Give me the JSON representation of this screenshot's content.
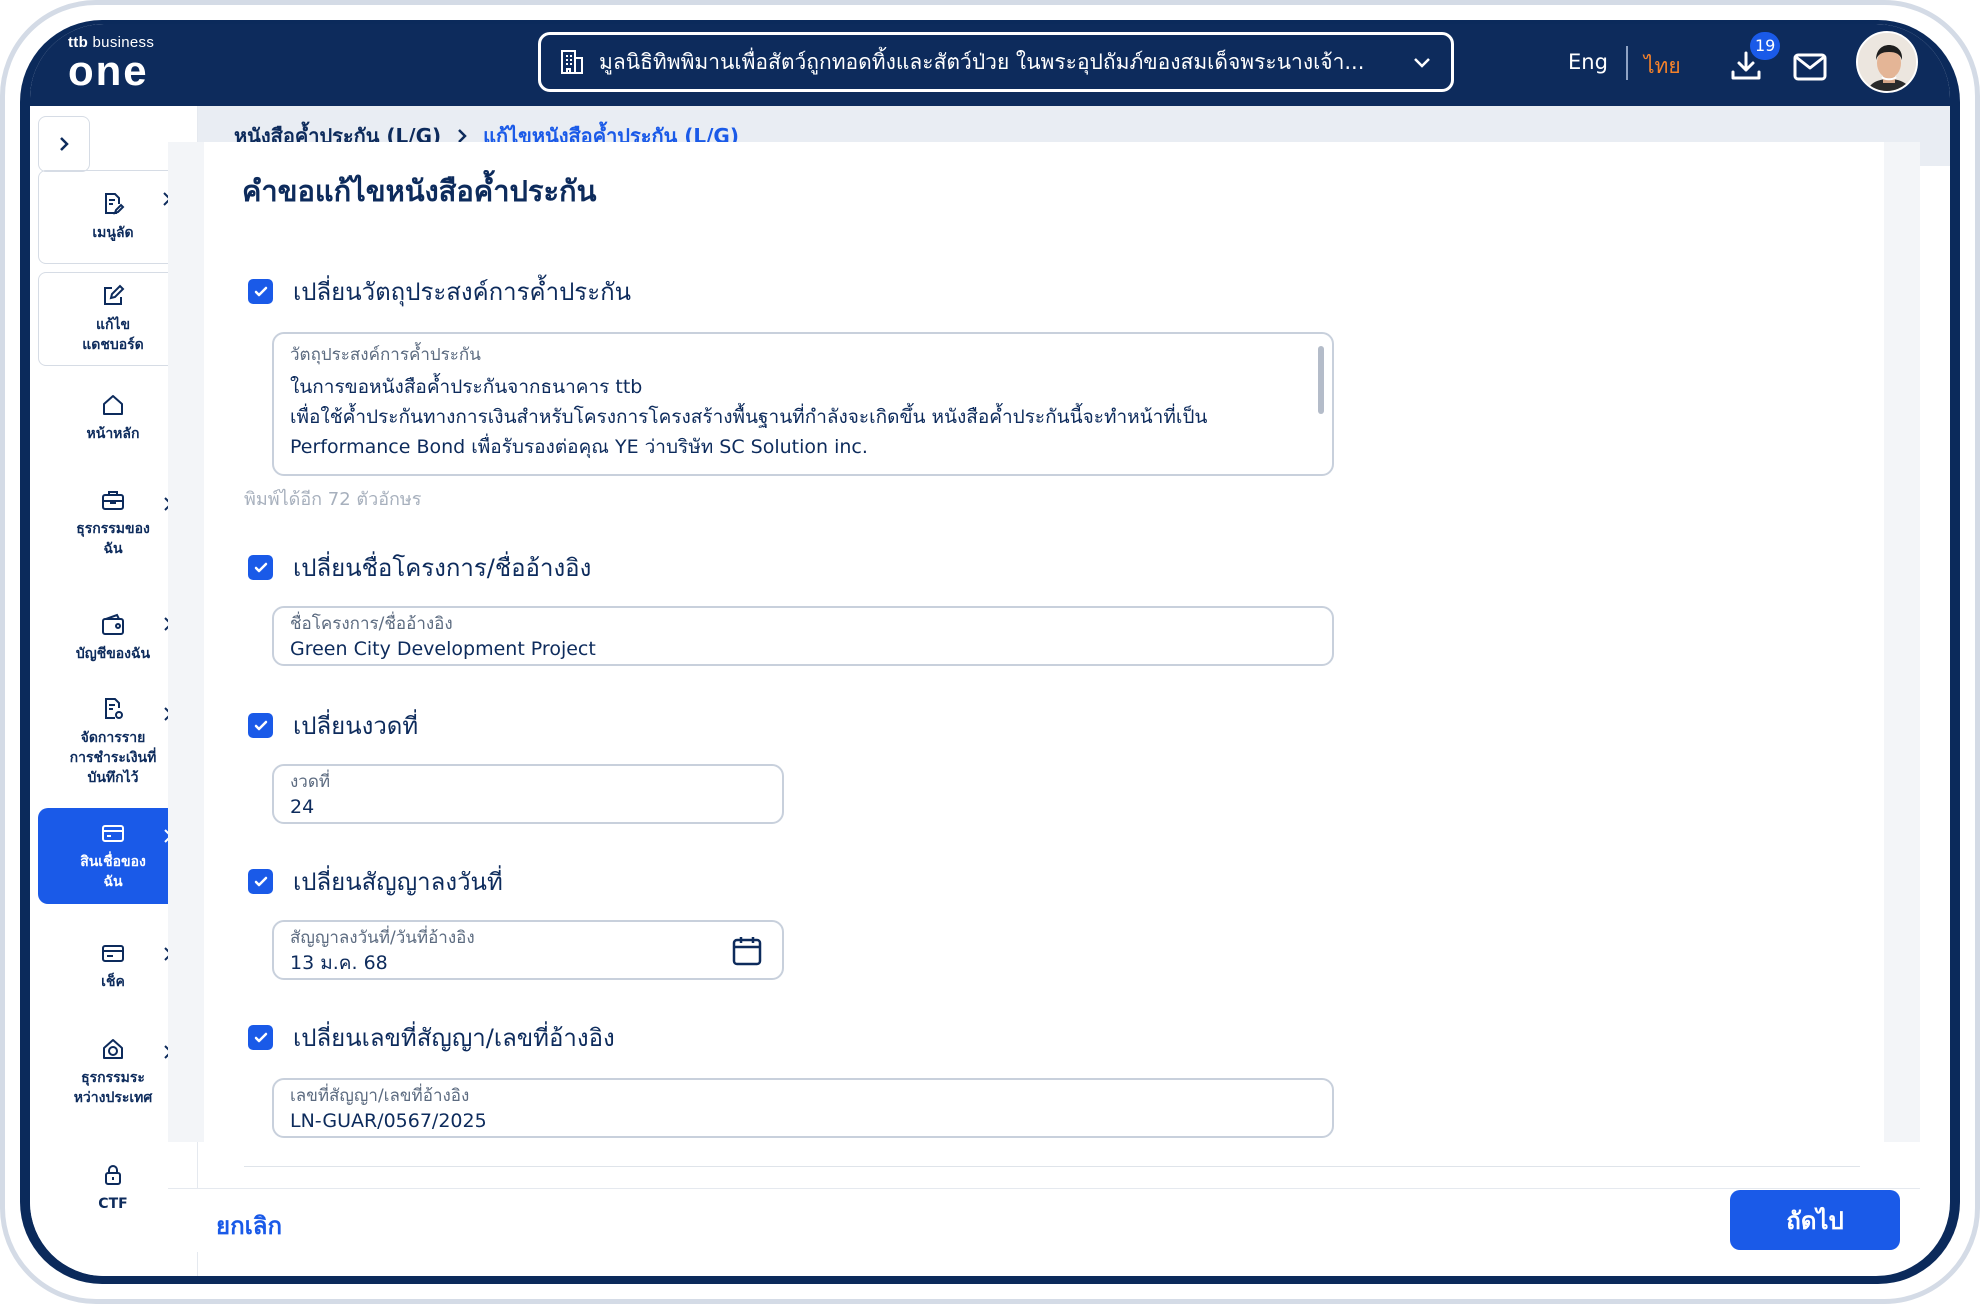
{
  "header": {
    "brand_small": "ttb",
    "brand_small2": "business",
    "brand_big": "one",
    "organization": "มูลนิธิทิพพิมานเพื่อสัตว์ถูกทอดทิ้งและสัตว์ป่วย ในพระอุปถัมภ์ของสมเด็จพระนางเจ้า...",
    "lang_en": "Eng",
    "lang_th": "ไทย",
    "download_count": "19"
  },
  "sidebar": {
    "items": [
      {
        "label": "เมนูลัด"
      },
      {
        "label": "แก้ไข\nแดชบอร์ด"
      },
      {
        "label": "หน้าหลัก"
      },
      {
        "label": "ธุรกรรมของ\nฉัน"
      },
      {
        "label": "บัญชีของฉัน"
      },
      {
        "label": "จัดการราย\nการชำระเงินที่\nบันทึกไว้"
      },
      {
        "label": "สินเชื่อของ\nฉัน"
      },
      {
        "label": "เช็ค"
      },
      {
        "label": "ธุรกรรมระ\nหว่างประเทศ"
      },
      {
        "label": "CTF"
      }
    ]
  },
  "breadcrumb": {
    "parent": "หนังสือค้ำประกัน (L/G)",
    "current": "แก้ไขหนังสือค้ำประกัน (L/G)"
  },
  "form": {
    "title": "คำขอแก้ไขหนังสือค้ำประกัน",
    "purpose": {
      "checkbox_label": "เปลี่ยนวัตถุประสงค์การค้ำประกัน",
      "field_label": "วัตถุประสงค์การค้ำประกัน",
      "line1": "ในการขอหนังสือค้ำประกันจากธนาคาร ttb",
      "line2": "เพื่อใช้ค้ำประกันทางการเงินสำหรับโครงการโครงสร้างพื้นฐานที่กำลังจะเกิดขึ้น หนังสือค้ำประกันนี้จะทำหน้าที่เป็น",
      "line3": "Performance Bond เพื่อรับรองต่อคุณ YE ว่าบริษัท SC Solution inc.",
      "counter": "พิมพ์ได้อีก 72 ตัวอักษร"
    },
    "project": {
      "checkbox_label": "เปลี่ยนชื่อโครงการ/ชื่ออ้างอิง",
      "field_label": "ชื่อโครงการ/ชื่ออ้างอิง",
      "value": "Green City Development Project"
    },
    "installment": {
      "checkbox_label": "เปลี่ยนงวดที่",
      "field_label": "งวดที่",
      "value": "24"
    },
    "contract_date": {
      "checkbox_label": "เปลี่ยนสัญญาลงวันที่",
      "field_label": "สัญญาลงวันที่/วันที่อ้างอิง",
      "value": "13 ม.ค. 68"
    },
    "contract_no": {
      "checkbox_label": "เปลี่ยนเลขที่สัญญา/เลขที่อ้างอิง",
      "field_label": "เลขที่สัญญา/เลขที่อ้างอิง",
      "value": "LN-GUAR/0567/2025"
    }
  },
  "footer": {
    "cancel": "ยกเลิก",
    "next": "ถัดไป"
  },
  "colors": {
    "navy": "#0d2b5c",
    "primary": "#1a5ae8",
    "accent": "#f5822a"
  }
}
